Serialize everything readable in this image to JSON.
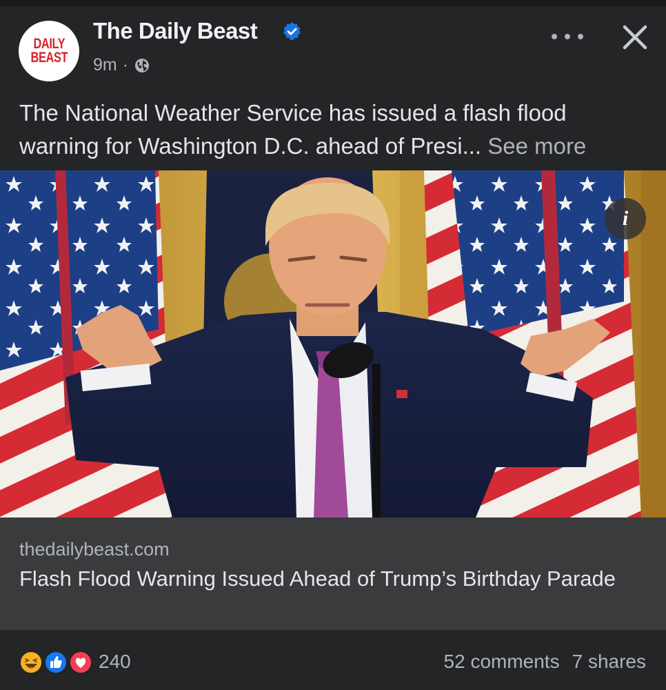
{
  "post": {
    "page_name": "The Daily Beast",
    "avatar_text": [
      "DAILY",
      "BEAST"
    ],
    "time": "9m",
    "separator": "·",
    "caption": "The National Weather Service has issued a flash flood warning for Washington D.C. ahead of Presi...",
    "see_more": "See more",
    "info_label": "i"
  },
  "link": {
    "domain": "thedailybeast.com",
    "title": "Flash Flood Warning Issued Ahead of Trump’s Birthday Parade"
  },
  "footer": {
    "reaction_count": "240",
    "comments": "52 comments",
    "shares": "7 shares"
  },
  "icons": {
    "verified": "verified-badge-icon",
    "privacy": "globe-icon",
    "more": "more-options-icon",
    "close": "close-icon",
    "reactions": [
      "haha-reaction-icon",
      "like-reaction-icon",
      "love-reaction-icon"
    ]
  },
  "colors": {
    "background": "#242526",
    "link_box": "#3a3b3c",
    "verified": "#1b74e4",
    "like": "#1877f2",
    "love": "#f33e58",
    "haha": "#f7b125"
  }
}
